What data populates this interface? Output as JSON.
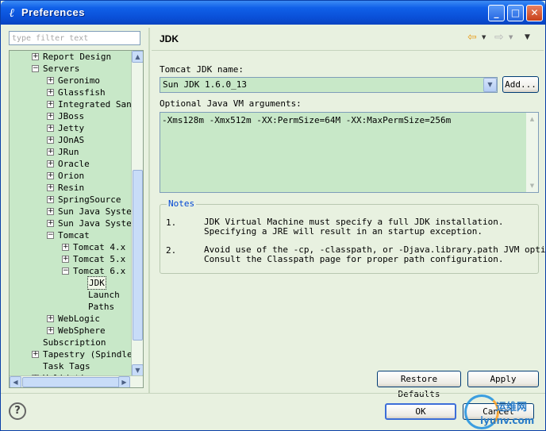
{
  "window": {
    "title": "Preferences",
    "minimize_glyph": "_",
    "maximize_glyph": "□",
    "close_glyph": "✕"
  },
  "filter": {
    "placeholder": "type filter text",
    "value": ""
  },
  "tree": {
    "items": [
      {
        "label": "Report Design",
        "expander": "+",
        "depth": 0
      },
      {
        "label": "Servers",
        "expander": "−",
        "depth": 0
      },
      {
        "label": "Geronimo",
        "expander": "+",
        "depth": 1
      },
      {
        "label": "Glassfish",
        "expander": "+",
        "depth": 1
      },
      {
        "label": "Integrated Sandbox",
        "expander": "+",
        "depth": 1
      },
      {
        "label": "JBoss",
        "expander": "+",
        "depth": 1
      },
      {
        "label": "Jetty",
        "expander": "+",
        "depth": 1
      },
      {
        "label": "JOnAS",
        "expander": "+",
        "depth": 1
      },
      {
        "label": "JRun",
        "expander": "+",
        "depth": 1
      },
      {
        "label": "Oracle",
        "expander": "+",
        "depth": 1
      },
      {
        "label": "Orion",
        "expander": "+",
        "depth": 1
      },
      {
        "label": "Resin",
        "expander": "+",
        "depth": 1
      },
      {
        "label": "SpringSource",
        "expander": "+",
        "depth": 1
      },
      {
        "label": "Sun Java System",
        "expander": "+",
        "depth": 1
      },
      {
        "label": "Sun Java System",
        "expander": "+",
        "depth": 1
      },
      {
        "label": "Tomcat",
        "expander": "−",
        "depth": 1
      },
      {
        "label": "Tomcat  4.x",
        "expander": "+",
        "depth": 2
      },
      {
        "label": "Tomcat  5.x",
        "expander": "+",
        "depth": 2
      },
      {
        "label": "Tomcat  6.x",
        "expander": "−",
        "depth": 2
      },
      {
        "label": "JDK",
        "expander": "",
        "depth": 3,
        "selected": true
      },
      {
        "label": "Launch",
        "expander": "",
        "depth": 3
      },
      {
        "label": "Paths",
        "expander": "",
        "depth": 3
      },
      {
        "label": "WebLogic",
        "expander": "+",
        "depth": 1
      },
      {
        "label": "WebSphere",
        "expander": "+",
        "depth": 1
      },
      {
        "label": "Subscription",
        "expander": "",
        "depth": 0
      },
      {
        "label": "Tapestry (Spindle)",
        "expander": "+",
        "depth": 0
      },
      {
        "label": "Task Tags",
        "expander": "",
        "depth": 0
      },
      {
        "label": "Validation",
        "expander": "+",
        "depth": 0
      }
    ]
  },
  "page": {
    "title": "JDK",
    "jdk_label": "Tomcat JDK name:",
    "jdk_value": "Sun JDK 1.6.0_13",
    "add_button": "Add...",
    "vm_args_label": "Optional Java VM arguments:",
    "vm_args_value": "-Xms128m -Xmx512m -XX:PermSize=64M -XX:MaxPermSize=256m",
    "notes_title": "Notes",
    "notes": [
      {
        "num": "1.",
        "lines": [
          "JDK Virtual Machine must specify a full JDK installation.",
          "Specifying a JRE will result in an startup exception."
        ]
      },
      {
        "num": "2.",
        "lines": [
          "Avoid use of the -cp, -classpath, or -Djava.library.path JVM options.",
          "Consult the Classpath page for proper path configuration."
        ]
      }
    ],
    "restore_defaults": "Restore Defaults",
    "apply": "Apply"
  },
  "dialog": {
    "ok": "OK",
    "cancel": "Cancel",
    "help_glyph": "?"
  },
  "watermark": {
    "text_cn": "运维网",
    "url": "iyunv.com"
  }
}
